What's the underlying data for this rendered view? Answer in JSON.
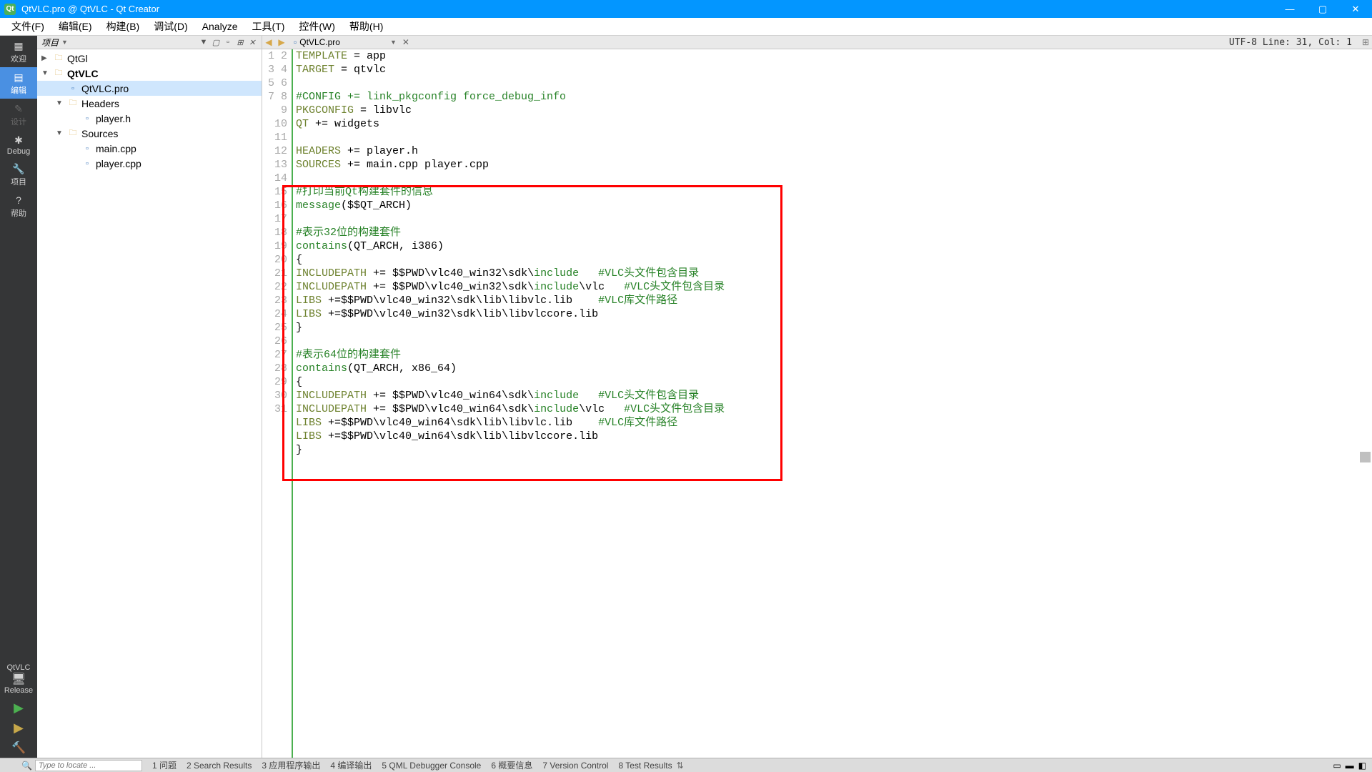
{
  "window": {
    "title": "QtVLC.pro @ QtVLC - Qt Creator"
  },
  "menubar": [
    "文件(F)",
    "编辑(E)",
    "构建(B)",
    "调试(D)",
    "Analyze",
    "工具(T)",
    "控件(W)",
    "帮助(H)"
  ],
  "modes": {
    "welcome": "欢迎",
    "edit": "编辑",
    "design": "设计",
    "debug": "Debug",
    "project": "项目",
    "help": "帮助",
    "target_name": "QtVLC",
    "target_kit": "Release"
  },
  "sidebar": {
    "header": "项目",
    "items": [
      {
        "indent": 0,
        "twist": "▶",
        "icon": "folder",
        "label": "QtGl",
        "bold": false
      },
      {
        "indent": 0,
        "twist": "▼",
        "icon": "folder",
        "label": "QtVLC",
        "bold": true
      },
      {
        "indent": 1,
        "twist": "",
        "icon": "pro",
        "label": "QtVLC.pro",
        "sel": true
      },
      {
        "indent": 1,
        "twist": "▼",
        "icon": "folder",
        "label": "Headers"
      },
      {
        "indent": 2,
        "twist": "",
        "icon": "h",
        "label": "player.h"
      },
      {
        "indent": 1,
        "twist": "▼",
        "icon": "folder",
        "label": "Sources"
      },
      {
        "indent": 2,
        "twist": "",
        "icon": "cpp",
        "label": "main.cpp"
      },
      {
        "indent": 2,
        "twist": "",
        "icon": "cpp",
        "label": "player.cpp"
      }
    ]
  },
  "tabbar": {
    "filename": "QtVLC.pro",
    "status": "UTF-8 Line: 31, Col: 1"
  },
  "code": {
    "lines": [
      {
        "n": 1,
        "seg": [
          {
            "t": "TEMPLATE",
            "c": "kw"
          },
          {
            "t": " = app"
          }
        ]
      },
      {
        "n": 2,
        "seg": [
          {
            "t": "TARGET",
            "c": "kw"
          },
          {
            "t": " = qtvlc"
          }
        ]
      },
      {
        "n": 3,
        "seg": [
          {
            "t": ""
          }
        ]
      },
      {
        "n": 4,
        "seg": [
          {
            "t": "#CONFIG += link_pkgconfig force_debug_info",
            "c": "cm"
          }
        ]
      },
      {
        "n": 5,
        "seg": [
          {
            "t": "PKGCONFIG",
            "c": "kw"
          },
          {
            "t": " = libvlc"
          }
        ]
      },
      {
        "n": 6,
        "seg": [
          {
            "t": "QT",
            "c": "kw"
          },
          {
            "t": " += widgets"
          }
        ]
      },
      {
        "n": 7,
        "seg": [
          {
            "t": ""
          }
        ]
      },
      {
        "n": 8,
        "seg": [
          {
            "t": "HEADERS",
            "c": "kw"
          },
          {
            "t": " += player.h"
          }
        ]
      },
      {
        "n": 9,
        "seg": [
          {
            "t": "SOURCES",
            "c": "kw"
          },
          {
            "t": " += main.cpp player.cpp"
          }
        ]
      },
      {
        "n": 10,
        "seg": [
          {
            "t": ""
          }
        ]
      },
      {
        "n": 11,
        "seg": [
          {
            "t": "#打印当前Qt构建套件的信息",
            "c": "cm"
          }
        ]
      },
      {
        "n": 12,
        "seg": [
          {
            "t": "message",
            "c": "fn"
          },
          {
            "t": "($$QT_ARCH)"
          }
        ]
      },
      {
        "n": 13,
        "seg": [
          {
            "t": ""
          }
        ]
      },
      {
        "n": 14,
        "seg": [
          {
            "t": "#表示32位的构建套件",
            "c": "cm"
          }
        ]
      },
      {
        "n": 15,
        "seg": [
          {
            "t": "contains",
            "c": "fn"
          },
          {
            "t": "(QT_ARCH, i386)"
          }
        ]
      },
      {
        "n": 16,
        "seg": [
          {
            "t": "{"
          }
        ]
      },
      {
        "n": 17,
        "seg": [
          {
            "t": "INCLUDEPATH",
            "c": "kw"
          },
          {
            "t": " += $$PWD\\vlc40_win32\\sdk\\"
          },
          {
            "t": "include",
            "c": "fn"
          },
          {
            "t": "   "
          },
          {
            "t": "#VLC头文件包含目录",
            "c": "cm"
          }
        ]
      },
      {
        "n": 18,
        "seg": [
          {
            "t": "INCLUDEPATH",
            "c": "kw"
          },
          {
            "t": " += $$PWD\\vlc40_win32\\sdk\\"
          },
          {
            "t": "include",
            "c": "fn"
          },
          {
            "t": "\\vlc   "
          },
          {
            "t": "#VLC头文件包含目录",
            "c": "cm"
          }
        ]
      },
      {
        "n": 19,
        "seg": [
          {
            "t": "LIBS",
            "c": "kw"
          },
          {
            "t": " +=$$PWD\\vlc40_win32\\sdk\\lib\\libvlc.lib    "
          },
          {
            "t": "#VLC库文件路径",
            "c": "cm"
          }
        ]
      },
      {
        "n": 20,
        "seg": [
          {
            "t": "LIBS",
            "c": "kw"
          },
          {
            "t": " +=$$PWD\\vlc40_win32\\sdk\\lib\\libvlccore.lib"
          }
        ]
      },
      {
        "n": 21,
        "seg": [
          {
            "t": "}"
          }
        ]
      },
      {
        "n": 22,
        "seg": [
          {
            "t": ""
          }
        ]
      },
      {
        "n": 23,
        "seg": [
          {
            "t": "#表示64位的构建套件",
            "c": "cm"
          }
        ]
      },
      {
        "n": 24,
        "seg": [
          {
            "t": "contains",
            "c": "fn"
          },
          {
            "t": "(QT_ARCH, x86_64)"
          }
        ]
      },
      {
        "n": 25,
        "seg": [
          {
            "t": "{"
          }
        ]
      },
      {
        "n": 26,
        "seg": [
          {
            "t": "INCLUDEPATH",
            "c": "kw"
          },
          {
            "t": " += $$PWD\\vlc40_win64\\sdk\\"
          },
          {
            "t": "include",
            "c": "fn"
          },
          {
            "t": "   "
          },
          {
            "t": "#VLC头文件包含目录",
            "c": "cm"
          }
        ]
      },
      {
        "n": 27,
        "seg": [
          {
            "t": "INCLUDEPATH",
            "c": "kw"
          },
          {
            "t": " += $$PWD\\vlc40_win64\\sdk\\"
          },
          {
            "t": "include",
            "c": "fn"
          },
          {
            "t": "\\vlc   "
          },
          {
            "t": "#VLC头文件包含目录",
            "c": "cm"
          }
        ]
      },
      {
        "n": 28,
        "seg": [
          {
            "t": "LIBS",
            "c": "kw"
          },
          {
            "t": " +=$$PWD\\vlc40_win64\\sdk\\lib\\libvlc.lib    "
          },
          {
            "t": "#VLC库文件路径",
            "c": "cm"
          }
        ]
      },
      {
        "n": 29,
        "seg": [
          {
            "t": "LIBS",
            "c": "kw"
          },
          {
            "t": " +=$$PWD\\vlc40_win64\\sdk\\lib\\libvlccore.lib"
          }
        ]
      },
      {
        "n": 30,
        "seg": [
          {
            "t": "}"
          }
        ]
      },
      {
        "n": 31,
        "seg": [
          {
            "t": ""
          }
        ],
        "hl": true
      }
    ]
  },
  "statusbar": {
    "locate_placeholder": "Type to locate ...",
    "panels": [
      "1 问题",
      "2 Search Results",
      "3 应用程序输出",
      "4 编译输出",
      "5 QML Debugger Console",
      "6 概要信息",
      "7 Version Control",
      "8 Test Results"
    ]
  }
}
